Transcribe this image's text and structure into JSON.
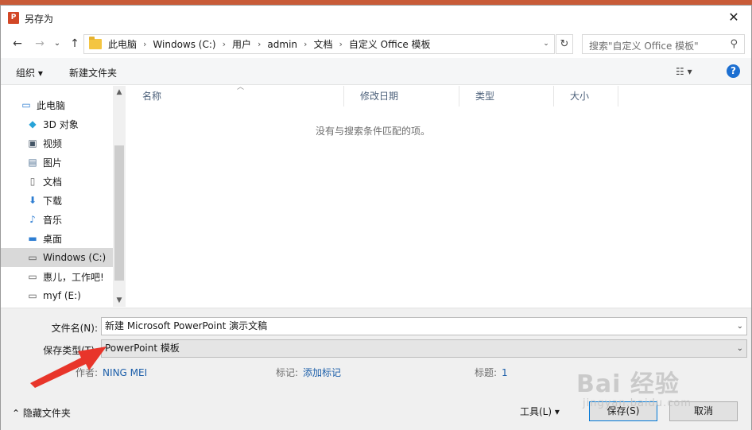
{
  "window": {
    "title": "另存为",
    "app_badge": "P",
    "close_glyph": "✕"
  },
  "navigation": {
    "back_glyph": "←",
    "forward_glyph": "→",
    "recent_glyph": "⌄",
    "up_glyph": "↑",
    "refresh_glyph": "↻",
    "breadcrumbs": [
      "此电脑",
      "Windows (C:)",
      "用户",
      "admin",
      "文档",
      "自定义 Office 模板"
    ],
    "search_placeholder": "搜索\"自定义 Office 模板\""
  },
  "toolbar": {
    "organize_label": "组织 ▾",
    "new_folder_label": "新建文件夹",
    "view_label": "☷ ▾",
    "help_label": "?"
  },
  "sidebar": {
    "items": [
      {
        "label": "此电脑",
        "icon": "computer-icon"
      },
      {
        "label": "3D 对象",
        "icon": "3d-objects-icon"
      },
      {
        "label": "视频",
        "icon": "video-icon"
      },
      {
        "label": "图片",
        "icon": "pictures-icon"
      },
      {
        "label": "文档",
        "icon": "documents-icon"
      },
      {
        "label": "下载",
        "icon": "downloads-icon"
      },
      {
        "label": "音乐",
        "icon": "music-icon"
      },
      {
        "label": "桌面",
        "icon": "desktop-icon"
      },
      {
        "label": "Windows (C:)",
        "icon": "drive-icon",
        "selected": true
      },
      {
        "label": "惠儿，工作吧!",
        "icon": "drive-icon"
      },
      {
        "label": "myf (E:)",
        "icon": "drive-icon"
      }
    ]
  },
  "filelist": {
    "columns": [
      "名称",
      "修改日期",
      "类型",
      "大小"
    ],
    "empty_message": "没有与搜索条件匹配的项。"
  },
  "form": {
    "filename_label": "文件名(N):",
    "filename_value": "新建 Microsoft PowerPoint 演示文稿",
    "filetype_label": "保存类型(T):",
    "filetype_value": "PowerPoint 模板",
    "author_label": "作者:",
    "author_value": "NING MEI",
    "tags_label": "标记:",
    "tags_value": "添加标记",
    "title_label": "标题:",
    "title_value": "1"
  },
  "footer": {
    "hide_folders_label": "⌃ 隐藏文件夹",
    "tools_label": "工具(L)  ▾",
    "save_label": "保存(S)",
    "cancel_label": "取消"
  },
  "watermark": {
    "main": "Bai 经验",
    "sub": "jingyan.baidu.com"
  },
  "colors": {
    "accent": "#0078d7",
    "app_icon": "#d24726",
    "link": "#1b5ea9",
    "arrow": "#e8352a"
  }
}
